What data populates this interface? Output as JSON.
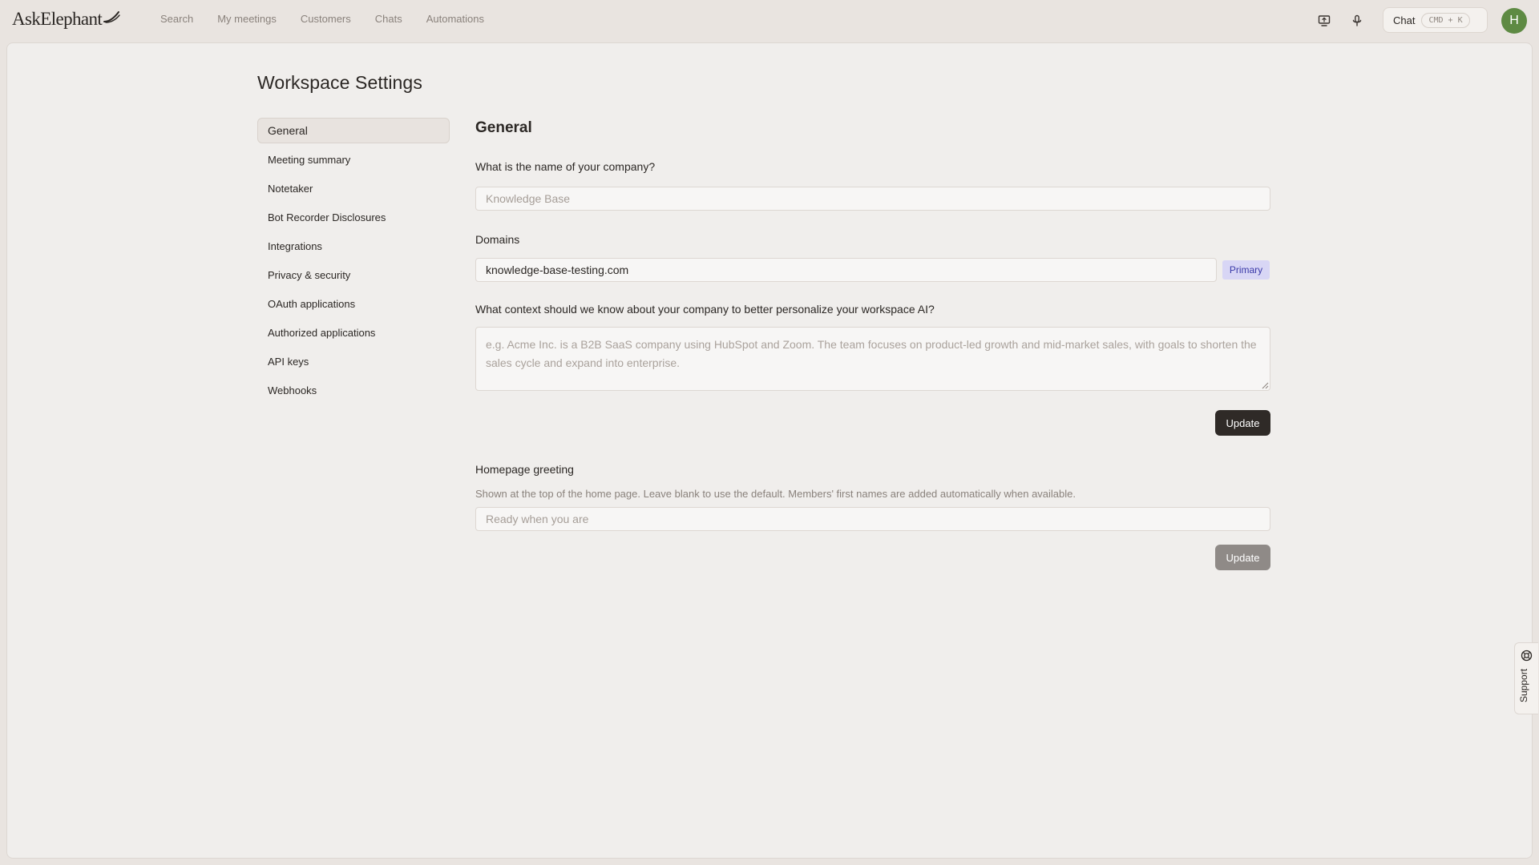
{
  "app": {
    "logo_text": "AskElephant"
  },
  "nav": {
    "items": [
      "Search",
      "My meetings",
      "Customers",
      "Chats",
      "Automations"
    ]
  },
  "topbar": {
    "screen_icon": "monitor-arrow-icon",
    "mic_icon": "microphone-icon",
    "chat_label": "Chat",
    "chat_shortcut": "CMD + K",
    "avatar_initial": "H",
    "avatar_color": "#5e8a43"
  },
  "page": {
    "title": "Workspace Settings"
  },
  "sidebar": {
    "items": [
      {
        "label": "General",
        "active": true
      },
      {
        "label": "Meeting summary"
      },
      {
        "label": "Notetaker"
      },
      {
        "label": "Bot Recorder Disclosures"
      },
      {
        "label": "Integrations"
      },
      {
        "label": "Privacy & security"
      },
      {
        "label": "OAuth applications"
      },
      {
        "label": "Authorized applications"
      },
      {
        "label": "API keys"
      },
      {
        "label": "Webhooks"
      }
    ]
  },
  "general": {
    "section_title": "General",
    "company_label": "What is the name of your company?",
    "company_placeholder": "Knowledge Base",
    "domains_label": "Domains",
    "domain_value": "knowledge-base-testing.com",
    "domain_badge": "Primary",
    "context_label": "What context should we know about your company to better personalize your workspace AI?",
    "context_placeholder": "e.g. Acme Inc. is a B2B SaaS company using HubSpot and Zoom. The team focuses on product-led growth and mid-market sales, with goals to shorten the sales cycle and expand into enterprise.",
    "update_label": "Update",
    "greeting_label": "Homepage greeting",
    "greeting_help": "Shown at the top of the home page. Leave blank to use the default. Members' first names are added automatically when available.",
    "greeting_placeholder": "Ready when you are",
    "greeting_update_label": "Update"
  },
  "support": {
    "label": "Support",
    "icon": "lifebuoy-icon"
  }
}
